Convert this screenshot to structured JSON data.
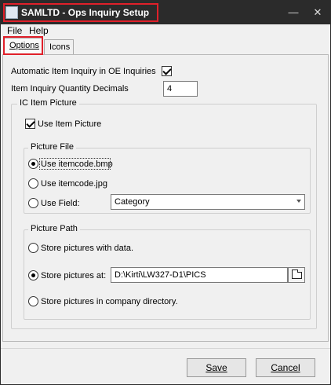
{
  "window": {
    "title": "SAMLTD - Ops Inquiry Setup",
    "minimize": "—",
    "close": "✕"
  },
  "menu": {
    "file": "File",
    "help": "Help"
  },
  "tabs": [
    {
      "label": "Options",
      "active": true
    },
    {
      "label": "Icons",
      "active": false
    }
  ],
  "options": {
    "auto_item_inquiry_label": "Automatic Item Inquiry in OE Inquiries",
    "auto_item_inquiry_checked": true,
    "qty_decimals_label": "Item Inquiry Quantity Decimals",
    "qty_decimals_value": "4"
  },
  "ic_item_picture": {
    "title": "IC Item Picture",
    "use_item_picture_label": "Use Item Picture",
    "use_item_picture_checked": true,
    "picture_file": {
      "title": "Picture File",
      "options": [
        {
          "label": "Use itemcode.bmp",
          "selected": true
        },
        {
          "label": "Use itemcode.jpg",
          "selected": false
        },
        {
          "label": "Use Field:",
          "selected": false
        }
      ],
      "field_value": "Category"
    },
    "picture_path": {
      "title": "Picture Path",
      "options": [
        {
          "label": "Store pictures with data.",
          "selected": false
        },
        {
          "label": "Store pictures at:",
          "selected": true
        },
        {
          "label": "Store pictures in company directory.",
          "selected": false
        }
      ],
      "path_value": "D:\\Kirti\\LW327-D1\\PICS"
    }
  },
  "buttons": {
    "save": "Save",
    "cancel": "Cancel"
  },
  "colors": {
    "highlight": "#e0202a",
    "titlebar": "#2b2b2b"
  }
}
